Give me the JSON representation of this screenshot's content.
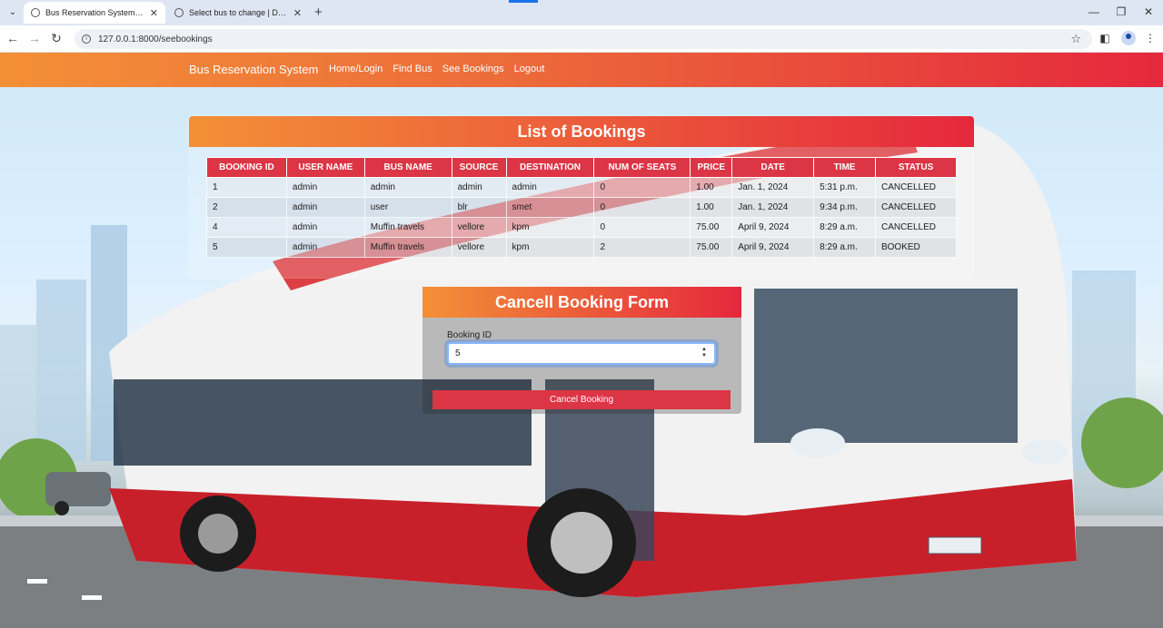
{
  "browser": {
    "tabs": [
      {
        "title": "Bus Reservation System in Djan",
        "active": true
      },
      {
        "title": "Select bus to change | Django s",
        "active": false
      }
    ],
    "url": "127.0.0.1:8000/seebookings"
  },
  "navbar": {
    "brand": "Bus Reservation System",
    "links": [
      "Home/Login",
      "Find Bus",
      "See Bookings",
      "Logout"
    ]
  },
  "bookings": {
    "title": "List of Bookings",
    "columns": [
      "BOOKING ID",
      "USER NAME",
      "BUS NAME",
      "SOURCE",
      "DESTINATION",
      "NUM OF SEATS",
      "PRICE",
      "DATE",
      "TIME",
      "STATUS"
    ],
    "rows": [
      [
        "1",
        "admin",
        "admin",
        "admin",
        "admin",
        "0",
        "1.00",
        "Jan. 1, 2024",
        "5:31 p.m.",
        "CANCELLED"
      ],
      [
        "2",
        "admin",
        "user",
        "blr",
        "smet",
        "0",
        "1.00",
        "Jan. 1, 2024",
        "9:34 p.m.",
        "CANCELLED"
      ],
      [
        "4",
        "admin",
        "Muffin travels",
        "vellore",
        "kpm",
        "0",
        "75.00",
        "April 9, 2024",
        "8:29 a.m.",
        "CANCELLED"
      ],
      [
        "5",
        "admin",
        "Muffin travels",
        "vellore",
        "kpm",
        "2",
        "75.00",
        "April 9, 2024",
        "8:29 a.m.",
        "BOOKED"
      ]
    ]
  },
  "cancel_form": {
    "title": "Cancell Booking Form",
    "field_label": "Booking ID",
    "field_value": "5",
    "button_label": "Cancel Booking"
  },
  "colors": {
    "navbar_start": "#f39037",
    "navbar_end": "#e5283d",
    "table_header": "#dc3545",
    "button": "#dc3545"
  },
  "icons": [
    "tab-list-icon",
    "globe-icon",
    "close-icon",
    "new-tab-icon",
    "back-icon",
    "forward-icon",
    "reload-icon",
    "site-info-icon",
    "bookmark-star-icon",
    "side-panel-icon",
    "profile-icon",
    "more-menu-icon",
    "minimize-icon",
    "restore-icon",
    "window-close-icon"
  ]
}
